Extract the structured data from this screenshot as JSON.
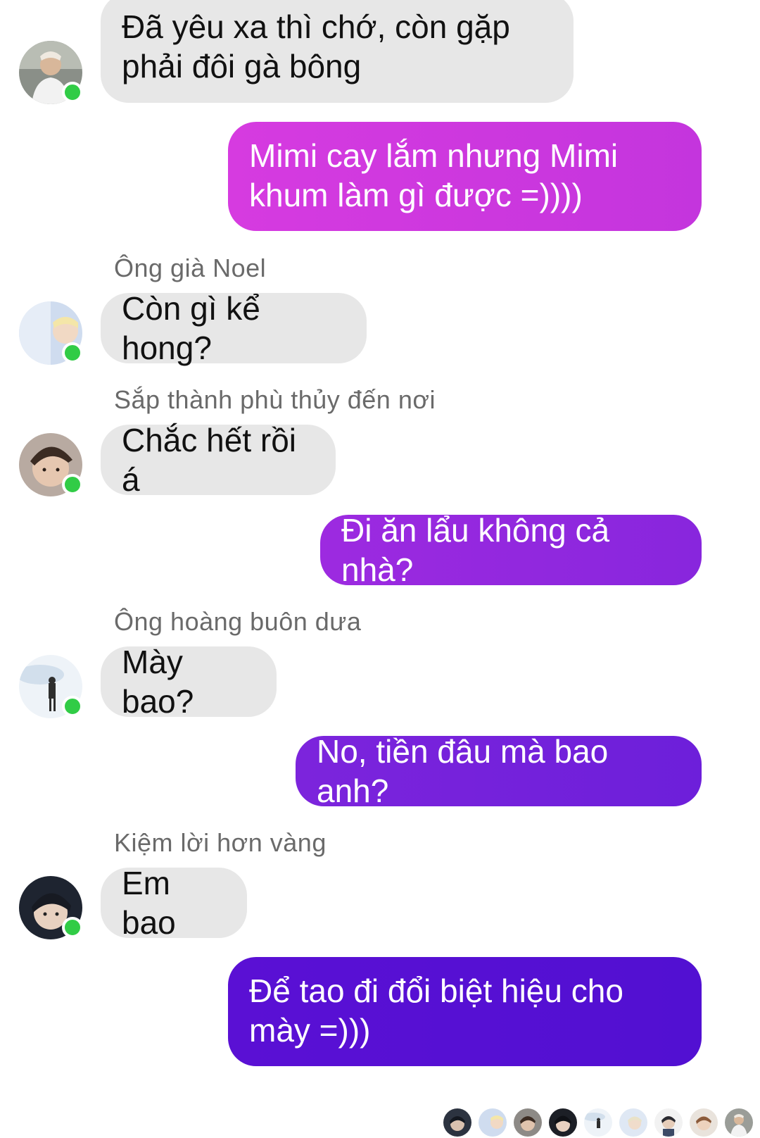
{
  "conversation": {
    "messages": [
      {
        "id": "m1",
        "direction": "incoming",
        "text": "Đã yêu xa thì chớ, còn gặp phải đôi gà bông"
      },
      {
        "id": "m2",
        "direction": "outgoing",
        "text": "Mimi cay lắm nhưng Mimi khum làm gì được =))))"
      },
      {
        "id": "m3",
        "direction": "incoming",
        "sender": "Ông già Noel",
        "text": "Còn gì kể hong?"
      },
      {
        "id": "m4",
        "direction": "incoming",
        "sender": "Sắp thành phù thủy đến nơi",
        "text": "Chắc hết rồi á"
      },
      {
        "id": "m5",
        "direction": "outgoing",
        "text": "Đi ăn lẩu không cả nhà?"
      },
      {
        "id": "m6",
        "direction": "incoming",
        "sender": "Ông hoàng buôn dưa",
        "text": "Mày bao?"
      },
      {
        "id": "m7",
        "direction": "outgoing",
        "text": "No, tiền đâu mà bao anh?"
      },
      {
        "id": "m8",
        "direction": "incoming",
        "sender": "Kiệm lời hơn vàng",
        "text": "Em bao"
      },
      {
        "id": "m9",
        "direction": "outgoing",
        "text": "Để tao đi đổi biệt hiệu cho mày =)))"
      }
    ],
    "seen_by_count": 9
  },
  "colors": {
    "incoming_bubble": "#e7e7e7",
    "outgoing_gradient": [
      "#d63be0",
      "#c032dc",
      "#9b2ae0",
      "#7a23dc",
      "#5a10d4"
    ],
    "online_dot": "#31cc46",
    "sender_name": "#6a6a6a"
  },
  "icons": {
    "online": "online-status-icon",
    "avatar": "avatar-photo"
  }
}
